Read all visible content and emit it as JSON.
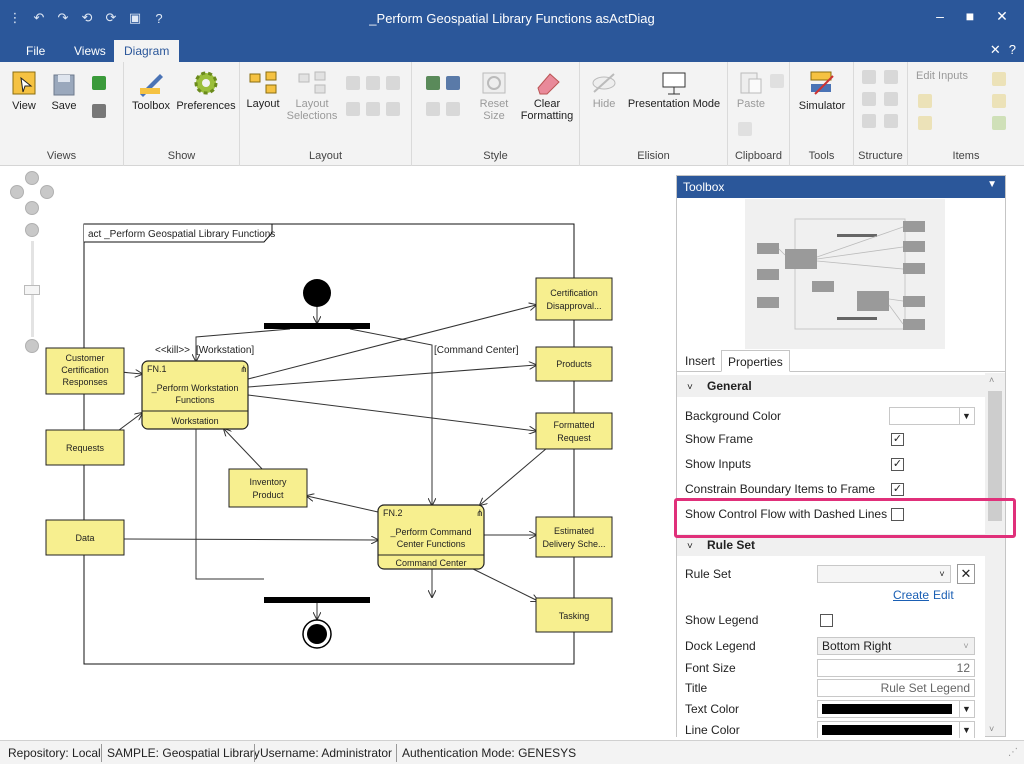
{
  "window": {
    "title": "_Perform Geospatial Library Functions asActDiag",
    "minimize": "–",
    "maximize": "■",
    "close": "✕"
  },
  "menu_tabs": [
    {
      "label": "File"
    },
    {
      "label": "Views"
    },
    {
      "label": "Diagram"
    }
  ],
  "ribbon": {
    "groups": {
      "views": "Views",
      "show": "Show",
      "layout": "Layout",
      "style": "Style",
      "elision": "Elision",
      "clipboard": "Clipboard",
      "tools": "Tools",
      "structure": "Structure",
      "items": "Items"
    },
    "buttons": {
      "view": "View",
      "save": "Save",
      "toolbox": "Toolbox",
      "preferences": "Preferences",
      "layout": "Layout",
      "layout_selections_1": "Layout",
      "layout_selections_2": "Selections",
      "reset_size_1": "Reset",
      "reset_size_2": "Size",
      "clear_formatting_1": "Clear",
      "clear_formatting_2": "Formatting",
      "hide": "Hide",
      "presentation_mode": "Presentation Mode",
      "paste": "Paste",
      "simulator": "Simulator",
      "edit_inputs": "Edit Inputs"
    }
  },
  "diagram": {
    "frame_title": "act _Perform Geospatial Library Functions",
    "nodes": {
      "customer_cert": [
        "Customer",
        "Certification",
        "Responses"
      ],
      "requests": "Requests",
      "data": "Data",
      "inventory": [
        "Inventory",
        "Product"
      ],
      "certification": [
        "Certification",
        "Disapproval..."
      ],
      "products": "Products",
      "formatted": [
        "Formatted",
        "Request"
      ],
      "estimated": [
        "Estimated",
        "Delivery Sche..."
      ],
      "tasking": "Tasking"
    },
    "fn1": {
      "id": "FN.1",
      "title": [
        "_Perform Workstation",
        "Functions"
      ],
      "performer": "Workstation"
    },
    "fn2": {
      "id": "FN.2",
      "title": [
        "_Perform Command",
        "Center Functions"
      ],
      "performer": "Command Center"
    },
    "labels": {
      "kill": "<<kill>>",
      "workstation_branch": "[Workstation]",
      "command_center_branch": "[Command Center]"
    }
  },
  "toolbox": {
    "title": "Toolbox",
    "tabs": [
      "Insert",
      "Properties"
    ],
    "active_tab": "Properties",
    "sections": {
      "general": "General",
      "rule_set": "Rule Set"
    },
    "properties": {
      "background_color": "Background Color",
      "show_frame": "Show Frame",
      "show_inputs": "Show Inputs",
      "constrain": "Constrain Boundary Items to Frame",
      "dashed": "Show Control Flow with Dashed Lines",
      "rule_set": "Rule Set",
      "create": "Create",
      "edit": "Edit",
      "show_legend": "Show Legend",
      "dock_legend": "Dock Legend",
      "dock_legend_value": "Bottom Right",
      "font_size": "Font Size",
      "font_size_value": "12",
      "title": "Title",
      "title_value": "Rule Set Legend",
      "text_color": "Text Color",
      "line_color": "Line Color"
    },
    "checks": {
      "show_frame": true,
      "show_inputs": true,
      "constrain": true,
      "dashed": false,
      "show_legend": false
    }
  },
  "status_bar": {
    "repository": "Repository: Local",
    "sample": "SAMPLE: Geospatial Library",
    "username": "Username: Administrator",
    "auth": "Authentication Mode: GENESYS"
  },
  "colors": {
    "title_bar": "#2b579a",
    "node_fill": "#f7ef8f",
    "highlight": "#e0307a"
  }
}
